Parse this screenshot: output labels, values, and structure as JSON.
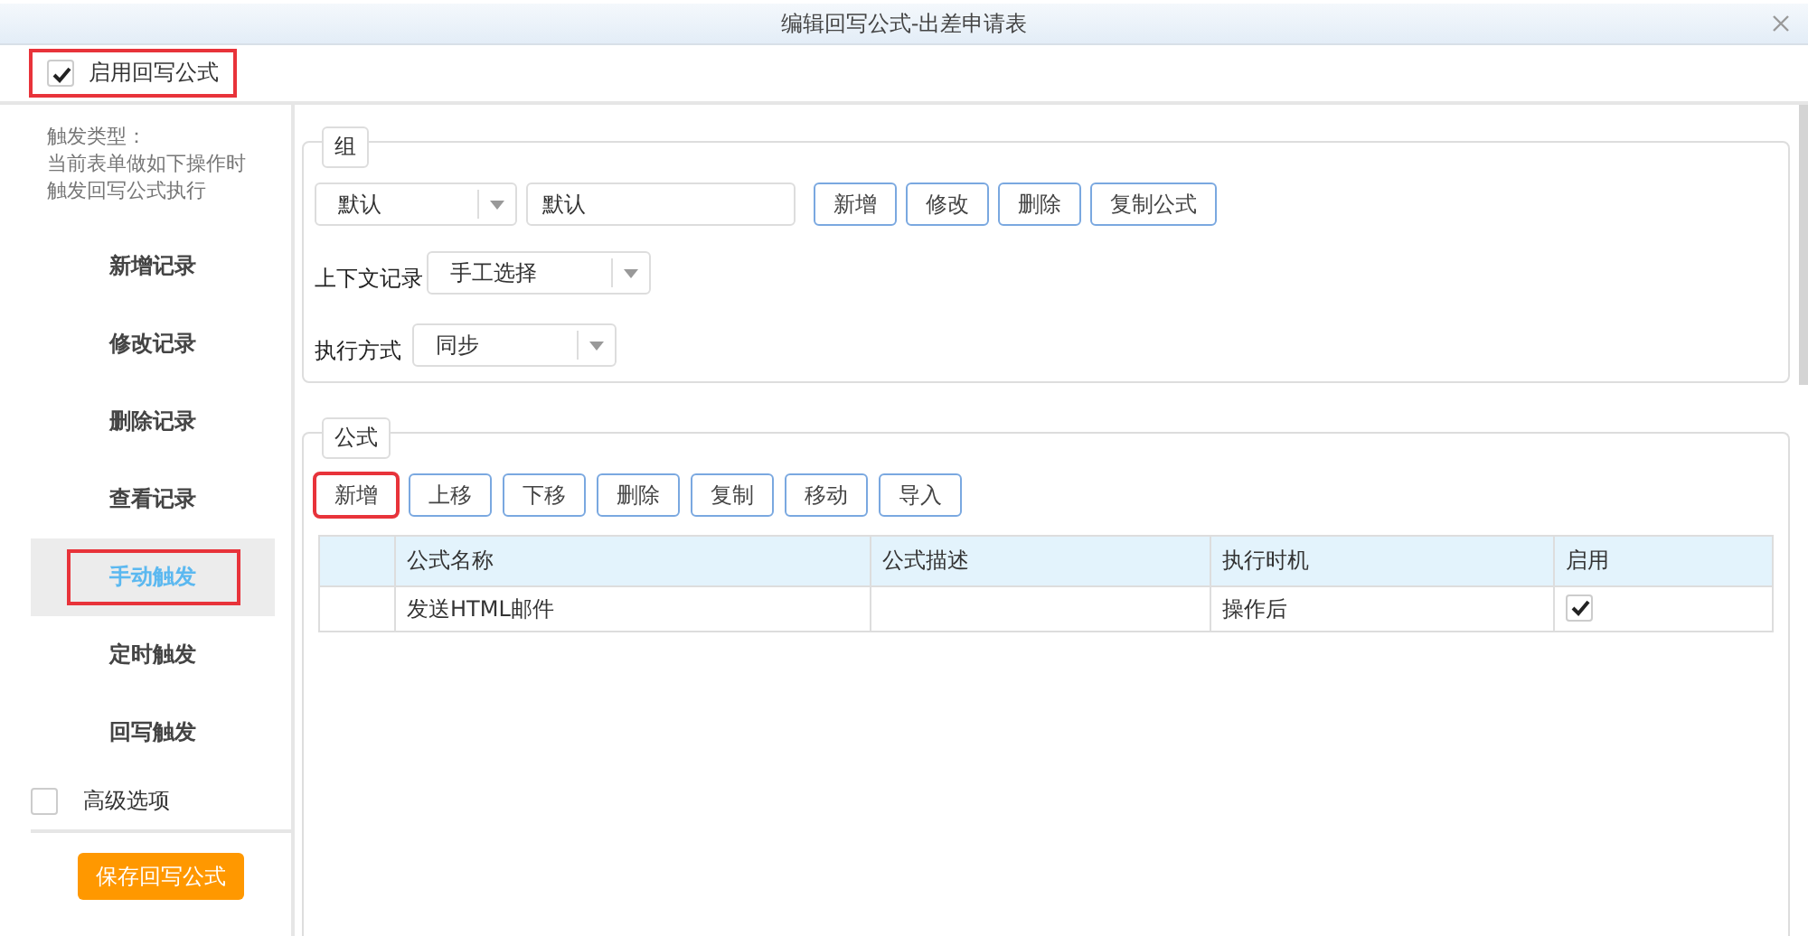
{
  "window": {
    "title": "编辑回写公式-出差申请表"
  },
  "enable_formula": {
    "label": "启用回写公式",
    "checked": true,
    "highlighted": true
  },
  "sidebar": {
    "description": [
      "触发类型：",
      "当前表单做如下操作时",
      "触发回写公式执行"
    ],
    "triggers": [
      {
        "label": "新增记录",
        "selected": false,
        "highlighted": false
      },
      {
        "label": "修改记录",
        "selected": false,
        "highlighted": false
      },
      {
        "label": "删除记录",
        "selected": false,
        "highlighted": false
      },
      {
        "label": "查看记录",
        "selected": false,
        "highlighted": false
      },
      {
        "label": "手动触发",
        "selected": true,
        "highlighted": true
      },
      {
        "label": "定时触发",
        "selected": false,
        "highlighted": false
      },
      {
        "label": "回写触发",
        "selected": false,
        "highlighted": false
      }
    ],
    "advanced": {
      "label": "高级选项",
      "checked": false
    },
    "save_button": {
      "label": "保存回写公式"
    }
  },
  "group": {
    "legend": "组",
    "group_select": {
      "value": "默认"
    },
    "name_input": {
      "value": "默认"
    },
    "buttons": [
      {
        "label": "新增"
      },
      {
        "label": "修改"
      },
      {
        "label": "删除"
      },
      {
        "label": "复制公式"
      }
    ],
    "context_record": {
      "label": "上下文记录",
      "value": "手工选择"
    },
    "exec_mode": {
      "label": "执行方式",
      "value": "同步"
    }
  },
  "formula": {
    "legend": "公式",
    "buttons": [
      {
        "label": "新增",
        "highlighted": true
      },
      {
        "label": "上移",
        "highlighted": false
      },
      {
        "label": "下移",
        "highlighted": false
      },
      {
        "label": "删除",
        "highlighted": false
      },
      {
        "label": "复制",
        "highlighted": false
      },
      {
        "label": "移动",
        "highlighted": false
      },
      {
        "label": "导入",
        "highlighted": false
      }
    ],
    "table": {
      "columns": [
        "公式名称",
        "公式描述",
        "执行时机",
        "启用"
      ],
      "rows": [
        {
          "name": "发送HTML邮件",
          "description": "",
          "timing": "操作后",
          "enabled": true
        }
      ]
    }
  }
}
